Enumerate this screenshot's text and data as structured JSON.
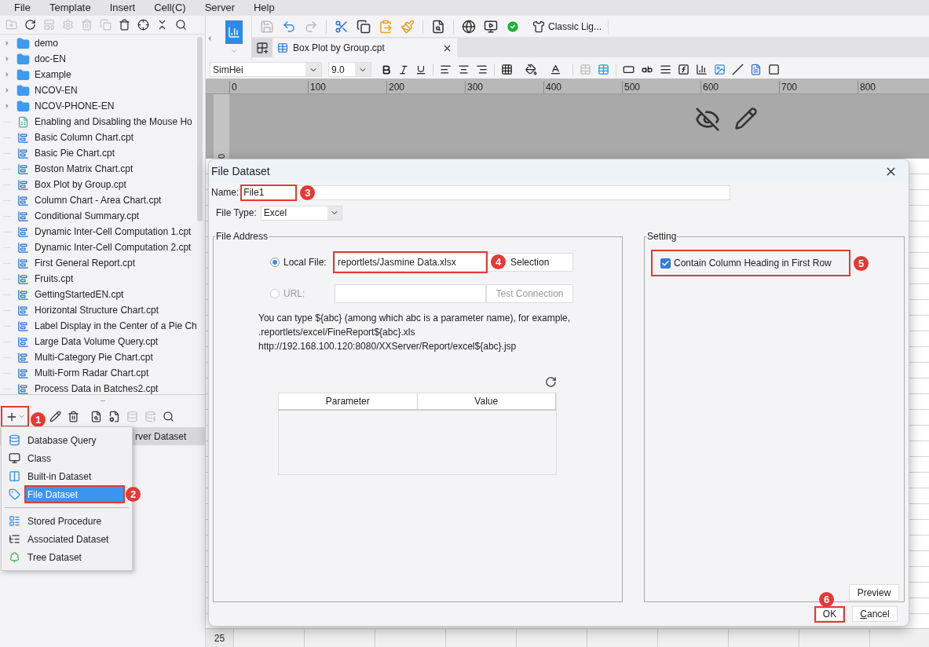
{
  "menu_bar": [
    "File",
    "Template",
    "Insert",
    "Cell(C)",
    "Server",
    "Help"
  ],
  "left_toolbar": [
    {
      "disabled": true
    },
    {
      "disabled": false
    },
    {
      "disabled": true
    },
    {
      "disabled": true
    },
    {
      "disabled": true
    },
    {
      "disabled": true
    },
    {
      "disabled": false
    },
    {
      "disabled": false
    },
    {
      "disabled": false
    },
    {
      "disabled": false
    }
  ],
  "tree": [
    {
      "name": "demo",
      "kind": "folder"
    },
    {
      "name": "doc-EN",
      "kind": "folder"
    },
    {
      "name": "Example",
      "kind": "folder"
    },
    {
      "name": "NCOV-EN",
      "kind": "folder"
    },
    {
      "name": "NCOV-PHONE-EN",
      "kind": "folder"
    },
    {
      "name": "Enabling and Disabling the Mouse Ho",
      "kind": "form"
    },
    {
      "name": "Basic Column Chart.cpt",
      "kind": "report"
    },
    {
      "name": "Basic Pie Chart.cpt",
      "kind": "report"
    },
    {
      "name": "Boston Matrix Chart.cpt",
      "kind": "report"
    },
    {
      "name": "Box Plot by Group.cpt",
      "kind": "report"
    },
    {
      "name": "Column Chart - Area Chart.cpt",
      "kind": "report"
    },
    {
      "name": "Conditional Summary.cpt",
      "kind": "report"
    },
    {
      "name": "Dynamic Inter-Cell Computation 1.cpt",
      "kind": "report"
    },
    {
      "name": "Dynamic Inter-Cell Computation 2.cpt",
      "kind": "report"
    },
    {
      "name": "First General Report.cpt",
      "kind": "report"
    },
    {
      "name": "Fruits.cpt",
      "kind": "report"
    },
    {
      "name": "GettingStartedEN.cpt",
      "kind": "report"
    },
    {
      "name": "Horizontal Structure Chart.cpt",
      "kind": "report"
    },
    {
      "name": "Label Display in the Center of a Pie Ch",
      "kind": "report"
    },
    {
      "name": "Large Data Volume Query.cpt",
      "kind": "report"
    },
    {
      "name": "Multi-Category Pie Chart.cpt",
      "kind": "report"
    },
    {
      "name": "Multi-Form Radar Chart.cpt",
      "kind": "report"
    },
    {
      "name": "Process Data in Batches2.cpt",
      "kind": "report"
    }
  ],
  "dataset_toolbar": {
    "add_button": {
      "highlighted": true,
      "callout": "1"
    },
    "tools": [
      {
        "disabled": false
      },
      {
        "disabled": false
      },
      {
        "disabled": false
      },
      {
        "disabled": false
      },
      {
        "disabled": true
      },
      {
        "disabled": true
      },
      {
        "disabled": false
      }
    ]
  },
  "dataset_list": [
    {
      "name": "rver Dataset",
      "selected": true
    }
  ],
  "dataset_menu": {
    "groups": [
      [
        {
          "label": "Database Query",
          "kind": "database",
          "selected": false,
          "highlighted": false
        },
        {
          "label": "Class",
          "kind": "class",
          "selected": false,
          "highlighted": false
        },
        {
          "label": "Built-in Dataset",
          "kind": "builtin",
          "selected": false,
          "highlighted": false
        },
        {
          "label": "File Dataset",
          "kind": "file",
          "selected": true,
          "highlighted": true,
          "callout": "2"
        }
      ],
      [
        {
          "label": "Stored Procedure",
          "kind": "procedure",
          "selected": false,
          "highlighted": false
        },
        {
          "label": "Associated Dataset",
          "kind": "associated",
          "selected": false,
          "highlighted": false
        },
        {
          "label": "Tree Dataset",
          "kind": "tree",
          "selected": false,
          "highlighted": false
        }
      ]
    ]
  },
  "main_toolbar": {
    "tools": [
      {
        "disabled": true
      },
      {
        "disabled": false
      },
      {
        "disabled": true
      },
      {
        "disabled": false
      },
      {
        "disabled": false
      },
      {
        "disabled": false
      },
      {
        "disabled": false
      },
      {
        "disabled": false
      },
      {
        "disabled": false
      },
      {
        "disabled": false
      },
      {
        "disabled": false
      }
    ],
    "theme_button": "Classic Lig..."
  },
  "tabs": [
    {
      "title": "Box Plot by Group.cpt",
      "selected": true
    }
  ],
  "format_toolbar": {
    "font": "SimHei",
    "size": "9.0"
  },
  "ruler": {
    "ticks": [
      "0",
      "100",
      "200",
      "300",
      "400",
      "500",
      "600",
      "700",
      "800"
    ],
    "vertical": "0"
  },
  "grid": {
    "row_label": "25"
  },
  "dialog": {
    "title": "File Dataset",
    "name": {
      "label": "Name:",
      "value": "File1",
      "highlighted": true,
      "callout": "3"
    },
    "file_type": {
      "label": "File Type:",
      "value": "Excel"
    },
    "file_address": {
      "legend": "File Address",
      "local_file": {
        "label": "Local File:",
        "selected": true,
        "value": "reportlets/Jasmine Data.xlsx",
        "highlighted": true,
        "callout": "4",
        "button": "Selection"
      },
      "url": {
        "label": "URL:",
        "selected": false,
        "disabled": true,
        "button": "Test Connection"
      },
      "help_lines": [
        "You can type ${abc} (among which abc is a parameter name), for example,",
        ".reportlets/excel/FineReport${abc}.xls",
        "http://192.168.100.120:8080/XXServer/Report/excel${abc}.jsp"
      ],
      "table": {
        "columns": [
          "Parameter",
          "Value"
        ]
      }
    },
    "setting": {
      "legend": "Setting",
      "checkbox": {
        "label": "Contain Column Heading in First Row",
        "checked": true,
        "highlighted": true,
        "callout": "5"
      },
      "preview_button": "Preview"
    },
    "ok": {
      "label": "OK",
      "highlighted": true,
      "callout": "6"
    },
    "cancel": "Cancel"
  }
}
